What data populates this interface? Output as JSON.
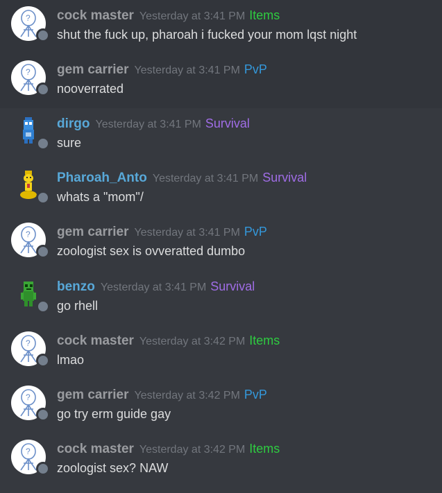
{
  "messages": [
    {
      "author": "cock master",
      "time": "Yesterday at 3:41 PM",
      "role": "Items",
      "role_type": "items",
      "text": "shut the fuck up, pharoah i fucked your mom lqst night",
      "avatar": "question-person-icon",
      "name_color": "grey"
    },
    {
      "author": "gem carrier",
      "time": "Yesterday at 3:41 PM",
      "role": "PvP",
      "role_type": "pvp",
      "text": "nooverrated",
      "avatar": "question-person-icon",
      "name_color": "grey"
    },
    {
      "author": "dirgo",
      "time": "Yesterday at 3:41 PM",
      "role": "Survival",
      "role_type": "survival",
      "text": "sure",
      "avatar": "blue-robot-icon",
      "name_color": "blue"
    },
    {
      "author": "Pharoah_Anto",
      "time": "Yesterday at 3:41 PM",
      "role": "Survival",
      "role_type": "survival",
      "text": "whats a \"mom\"/",
      "avatar": "yellow-figure-icon",
      "name_color": "blue"
    },
    {
      "author": "gem carrier",
      "time": "Yesterday at 3:41 PM",
      "role": "PvP",
      "role_type": "pvp",
      "text": "zoologist sex is ovveratted dumbo",
      "avatar": "question-person-icon",
      "name_color": "grey"
    },
    {
      "author": "benzo",
      "time": "Yesterday at 3:41 PM",
      "role": "Survival",
      "role_type": "survival",
      "text": "go rhell",
      "avatar": "green-zombie-icon",
      "name_color": "blue"
    },
    {
      "author": "cock master",
      "time": "Yesterday at 3:42 PM",
      "role": "Items",
      "role_type": "items",
      "text": "lmao",
      "avatar": "question-person-icon",
      "name_color": "grey"
    },
    {
      "author": "gem carrier",
      "time": "Yesterday at 3:42 PM",
      "role": "PvP",
      "role_type": "pvp",
      "text": "go try erm guide gay",
      "avatar": "question-person-icon",
      "name_color": "grey"
    },
    {
      "author": "cock master",
      "time": "Yesterday at 3:42 PM",
      "role": "Items",
      "role_type": "items",
      "text": "zoologist sex? NAW",
      "avatar": "question-person-icon",
      "name_color": "grey"
    }
  ],
  "colors": {
    "background": "#36393f",
    "highlight_row": "#32353b",
    "items_role": "#2ecc40",
    "pvp_role": "#3498db",
    "survival_role": "#a06de6",
    "blue_name": "#58a8d8"
  }
}
